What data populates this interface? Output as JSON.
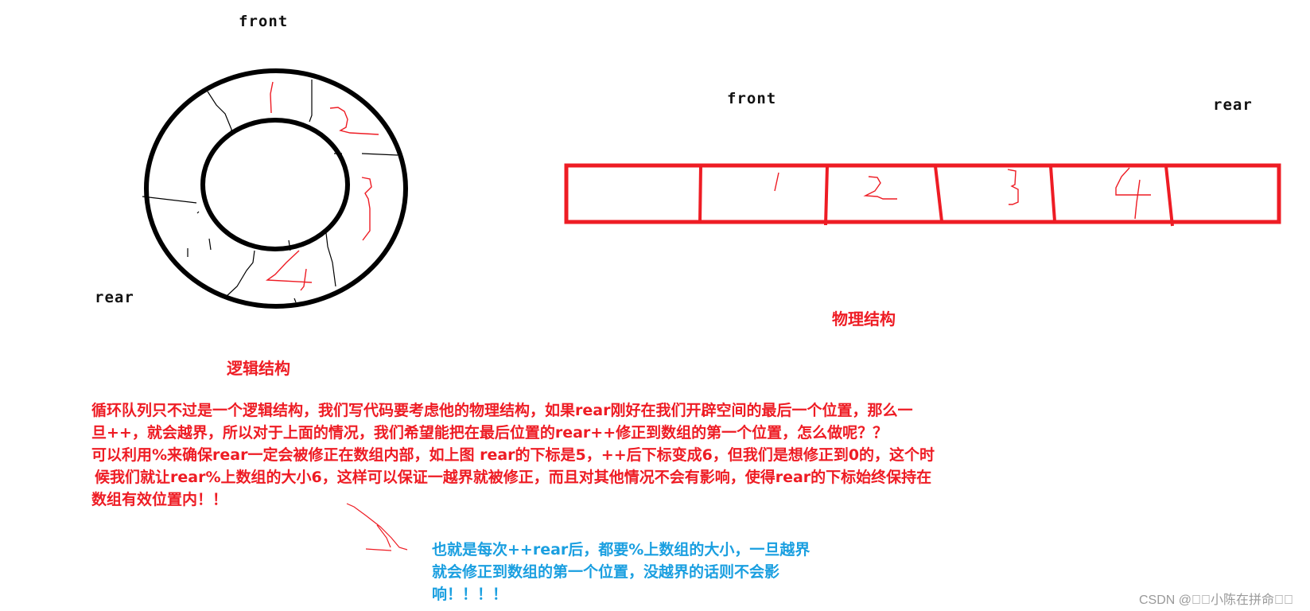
{
  "logical": {
    "front_label": "front",
    "rear_label": "rear",
    "caption": "逻辑结构",
    "slots": [
      "1",
      "2",
      "3",
      "4"
    ],
    "ring_color": "#000000",
    "digit_color": "#ee1c24"
  },
  "physical": {
    "front_label": "front",
    "rear_label": "rear",
    "caption": "物理结构",
    "cells": [
      "",
      "1",
      "2",
      "3",
      "4",
      ""
    ],
    "box_color": "#ee1c24"
  },
  "explanation": {
    "lines": [
      "循环队列只不过是一个逻辑结构，我们写代码要考虑他的物理结构，如果rear刚好在我们开辟空间的最后一个位置，那么一",
      "旦++，就会越界，所以对于上面的情况，我们希望能把在最后位置的rear++修正到数组的第一个位置，怎么做呢？？",
      "可以利用%来确保rear一定会被修正在数组内部，如上图 rear的下标是5，++后下标变成6，但我们是想修正到0的，这个时",
      "候我们就让rear%上数组的大小6，这样可以保证一越界就被修正，而且对其他情况不会有影响，使得rear的下标始终保持在",
      "数组有效位置内！！"
    ],
    "color": "#ee1c24"
  },
  "summary": {
    "lines": [
      "也就是每次++rear后，都要%上数组的大小，一旦越界",
      "就会修正到数组的第一个位置，没越界的话则不会影",
      "响！！！！"
    ],
    "color": "#1a9fe0"
  },
  "watermark": "CSDN @\u0000\u0000小陈在拼命\u0000\u0000"
}
